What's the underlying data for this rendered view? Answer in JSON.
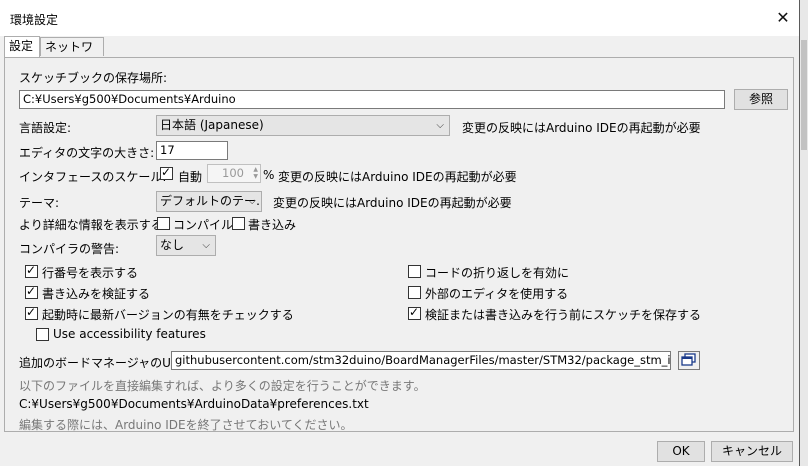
{
  "window": {
    "title": "環境設定",
    "close_glyph": "✕"
  },
  "tabs": [
    {
      "label": "設定",
      "active": true
    },
    {
      "label": "ネットワーク",
      "active": false
    }
  ],
  "sketchbook": {
    "label": "スケッチブックの保存場所:",
    "path": "C:¥Users¥g500¥Documents¥Arduino",
    "browse_label": "参照"
  },
  "language": {
    "label": "言語設定:",
    "value": "日本語 (Japanese)",
    "note": "変更の反映にはArduino IDEの再起動が必要"
  },
  "font_size": {
    "label": "エディタの文字の大きさ:",
    "value": "17"
  },
  "scale": {
    "label": "インタフェースのスケール:",
    "auto_label": "自動",
    "auto_checked": true,
    "value": "100",
    "unit": "%",
    "note": "変更の反映にはArduino IDEの再起動が必要"
  },
  "theme": {
    "label": "テーマ:",
    "value": "デフォルトのテー…",
    "note": "変更の反映にはArduino IDEの再起動が必要"
  },
  "verbose": {
    "label": "より詳細な情報を表示する:",
    "compile_label": "コンパイル",
    "compile_checked": false,
    "upload_label": "書き込み",
    "upload_checked": false
  },
  "warnings": {
    "label": "コンパイラの警告:",
    "value": "なし"
  },
  "options": {
    "line_numbers": {
      "label": "行番号を表示する",
      "checked": true
    },
    "code_folding": {
      "label": "コードの折り返しを有効に",
      "checked": false
    },
    "verify_upload": {
      "label": "書き込みを検証する",
      "checked": true
    },
    "external_editor": {
      "label": "外部のエディタを使用する",
      "checked": false
    },
    "check_updates": {
      "label": "起動時に最新バージョンの有無をチェックする",
      "checked": true
    },
    "save_before": {
      "label": "検証または書き込みを行う前にスケッチを保存する",
      "checked": true
    },
    "accessibility": {
      "label": "Use accessibility features",
      "checked": false
    }
  },
  "board_manager": {
    "label": "追加のボードマネージャのURL:",
    "url": "githubusercontent.com/stm32duino/BoardManagerFiles/master/STM32/package_stm_index.json"
  },
  "info": {
    "line1": "以下のファイルを直接編集すれば、より多くの設定を行うことができます。",
    "path": "C:¥Users¥g500¥Documents¥ArduinoData¥preferences.txt",
    "line2": "編集する際には、Arduino IDEを終了させておいてください。"
  },
  "footer": {
    "ok_label": "OK",
    "cancel_label": "キャンセル"
  }
}
